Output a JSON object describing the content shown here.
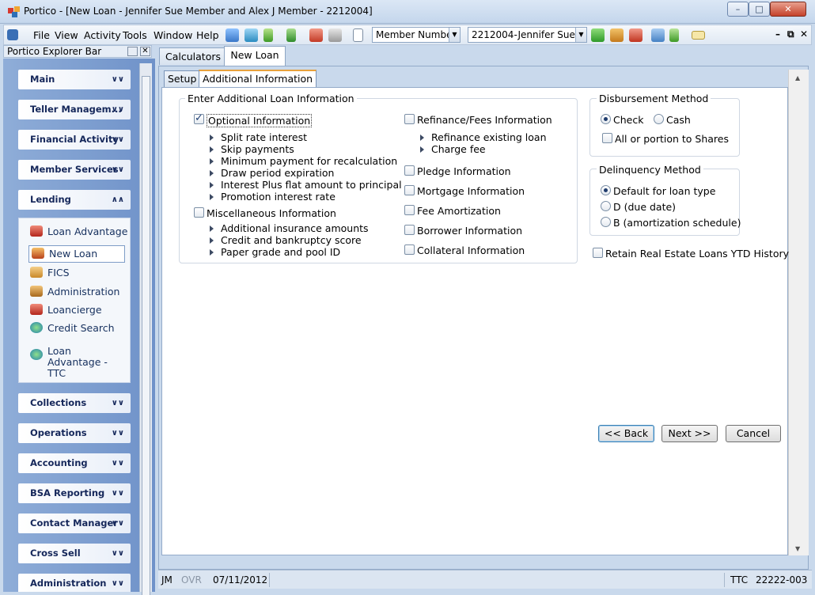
{
  "window": {
    "title": "Portico - [New Loan - Jennifer Sue Member and Alex J Member - 2212004]",
    "controls": {
      "min": "–",
      "max": "□",
      "close": "✕"
    }
  },
  "menubar": {
    "items": [
      "File",
      "View",
      "Activity",
      "Tools",
      "Window",
      "Help"
    ],
    "member_search_label": "Member Numbe",
    "member_selected": "2212004-Jennifer Sue",
    "mdi_controls": [
      "–",
      "⧉",
      "✕"
    ]
  },
  "explorer": {
    "header": "Portico Explorer Bar",
    "groups": [
      {
        "label": "Main"
      },
      {
        "label": "Teller Managem..."
      },
      {
        "label": "Financial Activity"
      },
      {
        "label": "Member Services"
      },
      {
        "label": "Lending"
      },
      {
        "label": "Collections"
      },
      {
        "label": "Operations"
      },
      {
        "label": "Accounting"
      },
      {
        "label": "BSA Reporting"
      },
      {
        "label": "Contact Manager"
      },
      {
        "label": "Cross Sell"
      },
      {
        "label": "Administration"
      }
    ],
    "lending_items": [
      "Loan Advantage",
      "New Loan",
      "FICS",
      "Administration",
      "Loancierge",
      "Credit Search",
      "Loan Advantage - TTC"
    ]
  },
  "tabs": {
    "top": [
      "Calculators",
      "New Loan"
    ],
    "sub": [
      "Setup",
      "Additional Information"
    ]
  },
  "form": {
    "loan_info_legend": "Enter Additional Loan Information",
    "optional": {
      "label": "Optional Information",
      "checked": true,
      "items": [
        "Split rate interest",
        "Skip payments",
        "Minimum payment for recalculation",
        "Draw period expiration",
        "Interest Plus flat amount to principal",
        "Promotion interest rate"
      ]
    },
    "misc": {
      "label": "Miscellaneous Information",
      "checked": false,
      "items": [
        "Additional insurance amounts",
        "Credit and bankruptcy score",
        "Paper grade and pool ID"
      ]
    },
    "refinance": {
      "label": "Refinance/Fees Information",
      "checked": false,
      "items": [
        "Refinance existing loan",
        "Charge fee"
      ]
    },
    "pledge": "Pledge Information",
    "mortgage": "Mortgage Information",
    "fee_amortization": "Fee Amortization",
    "borrower": "Borrower Information",
    "collateral": "Collateral Information",
    "disbursement": {
      "legend": "Disbursement Method",
      "check": "Check",
      "cash": "Cash",
      "shares": "All or portion to Shares",
      "selected": "Check"
    },
    "delinquency": {
      "legend": "Delinquency Method",
      "options": [
        "Default for loan type",
        "D (due date)",
        "B (amortization schedule)"
      ],
      "selected": "Default for loan type"
    },
    "retain_ytd": "Retain Real Estate Loans YTD History"
  },
  "buttons": {
    "back": "<< Back",
    "next": "Next >>",
    "cancel": "Cancel"
  },
  "status": {
    "user": "JM",
    "ovr": "OVR",
    "date": "07/11/2012",
    "branch": "TTC",
    "terminal": "22222-003"
  },
  "colors": {
    "accent_tab": "#e8a23c",
    "explorer_bg": "#7f9fd0",
    "selection": "#1f3c6d"
  }
}
